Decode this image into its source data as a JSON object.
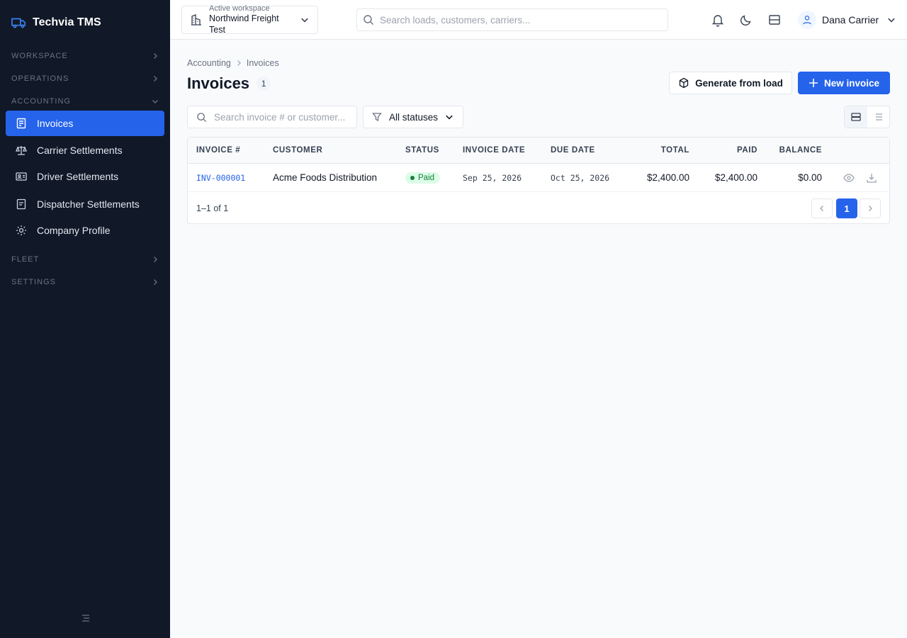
{
  "app": {
    "name": "Techvia TMS"
  },
  "sidebar": {
    "sections": [
      {
        "label": "WORKSPACE"
      },
      {
        "label": "OPERATIONS"
      },
      {
        "label": "ACCOUNTING"
      },
      {
        "label": "FLEET"
      },
      {
        "label": "SETTINGS"
      }
    ],
    "accounting_items": [
      {
        "label": "Invoices",
        "icon": "receipt-icon",
        "active": true
      },
      {
        "label": "Carrier Settlements",
        "icon": "scale-icon"
      },
      {
        "label": "Driver Settlements",
        "icon": "id-card-icon"
      },
      {
        "label": "Dispatcher Settlements",
        "icon": "document-icon"
      },
      {
        "label": "Company Profile",
        "icon": "gear-icon"
      }
    ]
  },
  "topbar": {
    "workspace_caption": "Active workspace",
    "workspace_name": "Northwind Freight Test",
    "search_placeholder": "Search loads, customers, carriers...",
    "user_name": "Dana Carrier"
  },
  "breadcrumb": {
    "parent": "Accounting",
    "current": "Invoices"
  },
  "page": {
    "title": "Invoices",
    "count": "1",
    "generate_label": "Generate from load",
    "new_label": "New invoice"
  },
  "filters": {
    "search_placeholder": "Search invoice # or customer...",
    "status_value": "All statuses"
  },
  "table": {
    "columns": [
      "INVOICE #",
      "CUSTOMER",
      "STATUS",
      "INVOICE DATE",
      "DUE DATE",
      "TOTAL",
      "PAID",
      "BALANCE"
    ],
    "rows": [
      {
        "invoice": "INV-000001",
        "customer": "Acme Foods Distribution",
        "status": "Paid",
        "invoice_date": "Sep 25, 2026",
        "due_date": "Oct 25, 2026",
        "total": "$2,400.00",
        "paid": "$2,400.00",
        "balance": "$0.00"
      }
    ],
    "range_text": "1–1 of 1",
    "current_page": "1"
  },
  "colors": {
    "accent": "#2563eb",
    "sidebar_bg": "#111827",
    "paid_bg": "#dcfce7",
    "paid_fg": "#15803d"
  }
}
